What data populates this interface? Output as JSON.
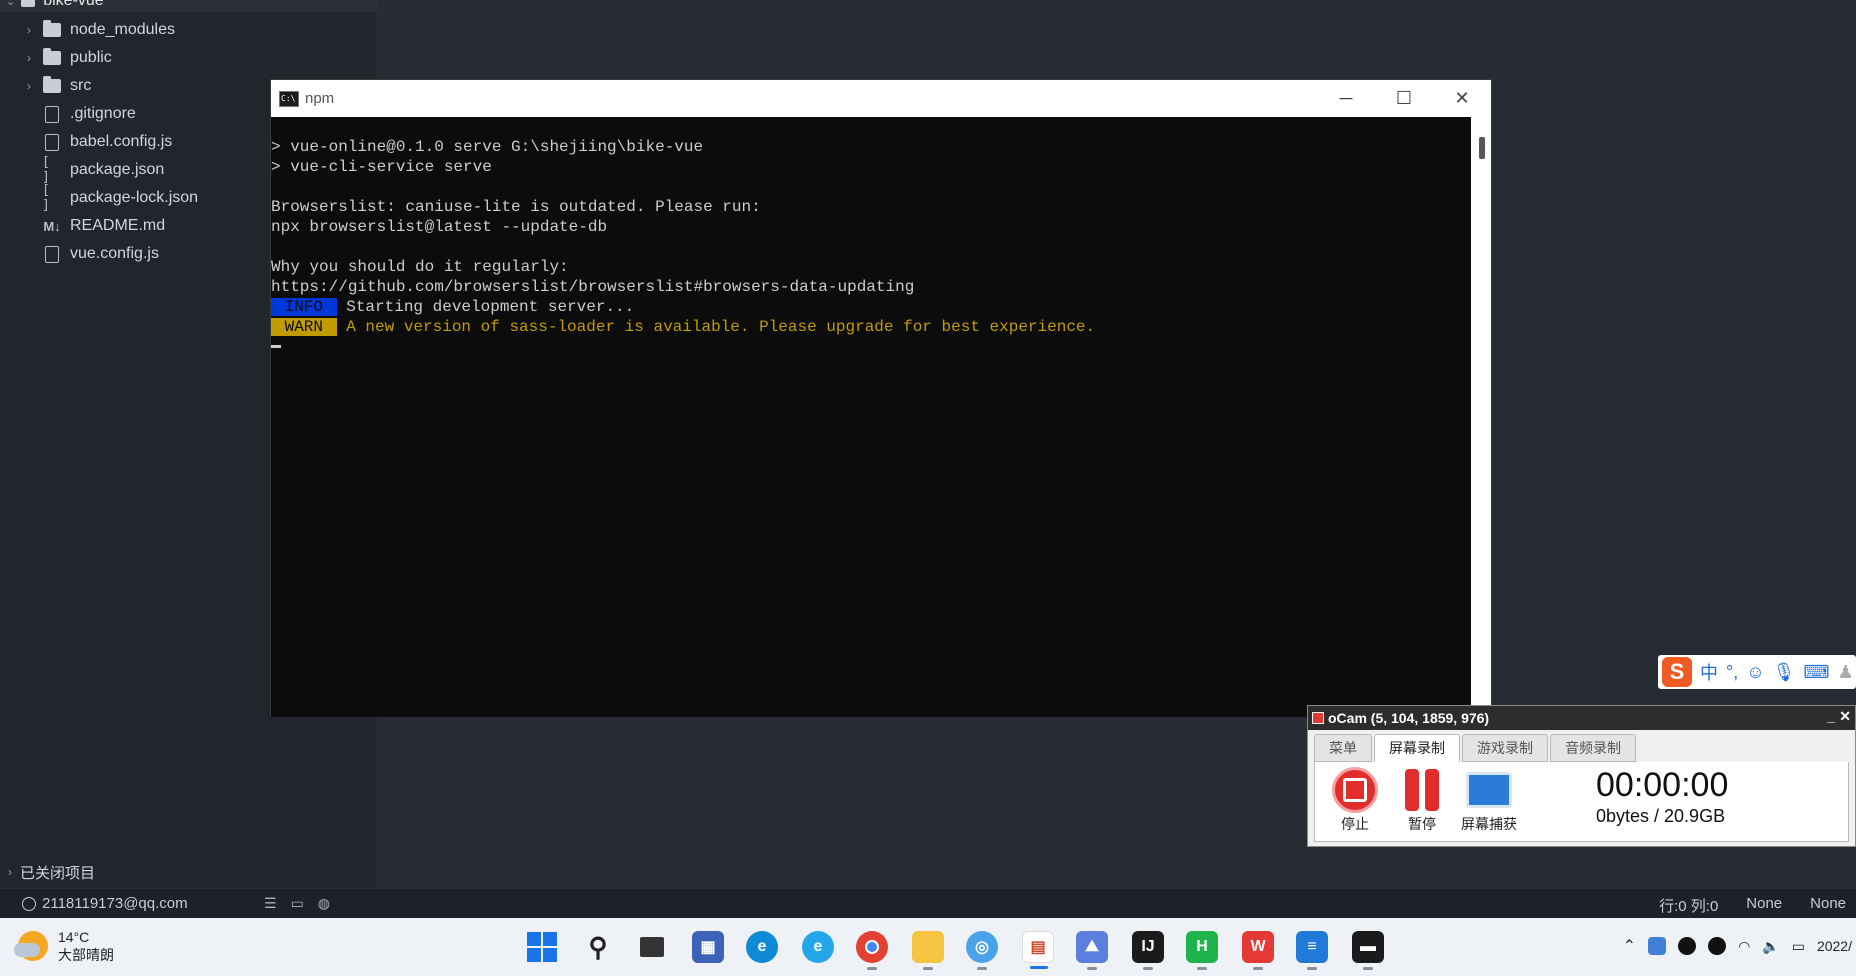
{
  "explorer": {
    "root_label": "bike-vue",
    "items": [
      {
        "label": "node_modules",
        "kind": "folder",
        "icon": "folder-icon"
      },
      {
        "label": "public",
        "kind": "folder",
        "icon": "folder-icon"
      },
      {
        "label": "src",
        "kind": "folder",
        "icon": "folder-icon"
      },
      {
        "label": ".gitignore",
        "kind": "file",
        "icon": "file-icon"
      },
      {
        "label": "babel.config.js",
        "kind": "file",
        "icon": "file-icon"
      },
      {
        "label": "package.json",
        "kind": "json",
        "icon": "json-icon"
      },
      {
        "label": "package-lock.json",
        "kind": "json",
        "icon": "json-icon"
      },
      {
        "label": "README.md",
        "kind": "markdown",
        "icon": "markdown-icon"
      },
      {
        "label": "vue.config.js",
        "kind": "file",
        "icon": "file-icon"
      }
    ],
    "closed_projects_label": "已关闭项目"
  },
  "statusbar": {
    "user": "2118119173@qq.com",
    "position": "行:0  列:0",
    "encoding": "None",
    "language": "None"
  },
  "npm_window": {
    "title": "npm",
    "lines": [
      "> vue-online@0.1.0 serve G:\\shejiing\\bike-vue",
      "> vue-cli-service serve",
      "",
      "Browserslist: caniuse-lite is outdated. Please run:",
      "npx browserslist@latest --update-db",
      "",
      "Why you should do it regularly:",
      "https://github.com/browserslist/browserslist#browsers-data-updating"
    ],
    "info_tag": " INFO ",
    "info_text": " Starting development server...",
    "warn_tag": " WARN ",
    "warn_text": " A new version of sass-loader is available. Please upgrade for best experience.",
    "colors": {
      "info": "#0037da",
      "warn": "#c19c00"
    }
  },
  "ime": {
    "logo": "S",
    "mode": "中",
    "punct": "°,"
  },
  "ocam": {
    "title": "oCam (5, 104, 1859, 976)",
    "tabs": [
      "菜单",
      "屏幕录制",
      "游戏录制",
      "音频录制"
    ],
    "active_tab": "屏幕录制",
    "stop_label": "停止",
    "pause_label": "暂停",
    "capture_label": "屏幕捕获",
    "time": "00:00:00",
    "size": "0bytes / 20.9GB"
  },
  "taskbar": {
    "weather_temp": "14°C",
    "weather_desc": "大部晴朗",
    "date": "2022/",
    "apps": [
      "start-icon",
      "search-icon",
      "task-view-icon",
      "app-icon",
      "edge-icon",
      "ie-icon",
      "chrome-icon",
      "file-explorer-icon",
      "photo-icon",
      "powerpoint-icon",
      "paint-icon",
      "intellij-icon",
      "hbuilder-icon",
      "wps-icon",
      "notepad-icon",
      "terminal-icon"
    ]
  }
}
